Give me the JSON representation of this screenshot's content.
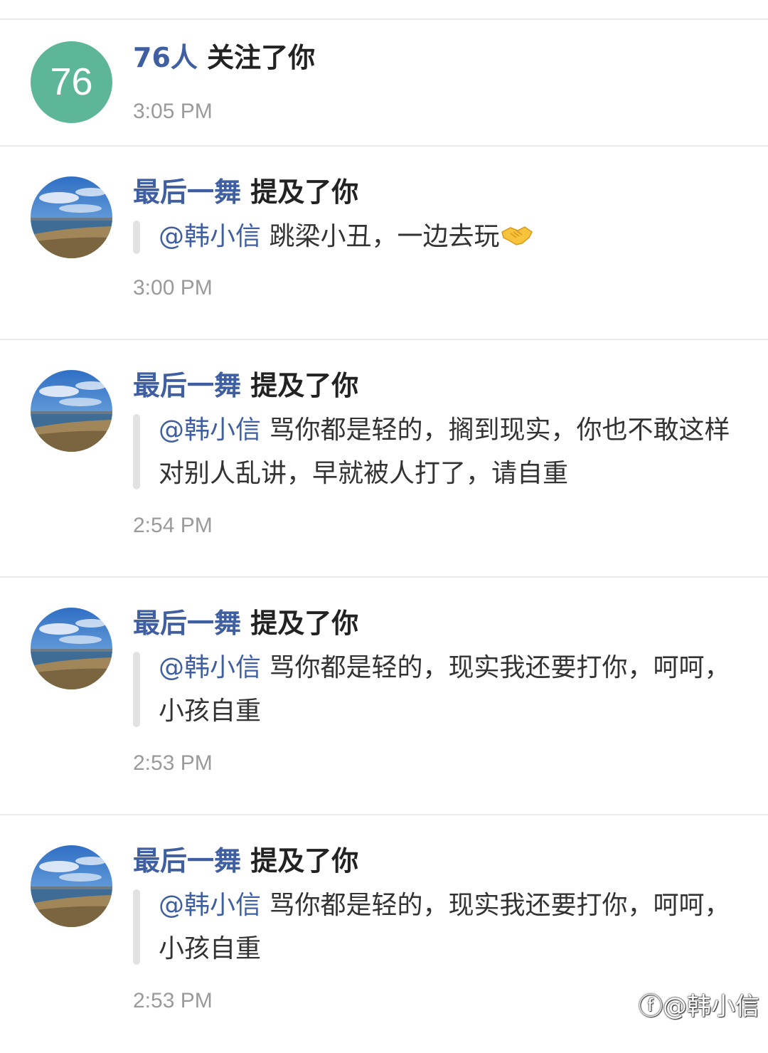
{
  "notifications": [
    {
      "type": "follow",
      "avatar_text": "76",
      "actor": "76人",
      "action": "关注了你",
      "time": "3:05 PM"
    },
    {
      "type": "mention",
      "actor": "最后一舞",
      "action": "提及了你",
      "mention": "@韩小信",
      "text": "跳梁小丑，一边去玩",
      "emoji": "handshake-emoji",
      "time": "3:00 PM"
    },
    {
      "type": "mention",
      "actor": "最后一舞",
      "action": "提及了你",
      "mention": "@韩小信",
      "text": "骂你都是轻的，搁到现实，你也不敢这样对别人乱讲，早就被人打了，请自重",
      "time": "2:54 PM"
    },
    {
      "type": "mention",
      "actor": "最后一舞",
      "action": "提及了你",
      "mention": "@韩小信",
      "text": "骂你都是轻的，现实我还要打你，呵呵，小孩自重",
      "time": "2:53 PM"
    },
    {
      "type": "mention",
      "actor": "最后一舞",
      "action": "提及了你",
      "mention": "@韩小信",
      "text": "骂你都是轻的，现实我还要打你，呵呵，小孩自重",
      "time": "2:53 PM"
    }
  ],
  "watermark": "@韩小信",
  "colors": {
    "accent": "#3f5fa1",
    "avatar_green": "#5cb697",
    "timestamp": "#9a9a9a",
    "divider": "#ececec"
  }
}
